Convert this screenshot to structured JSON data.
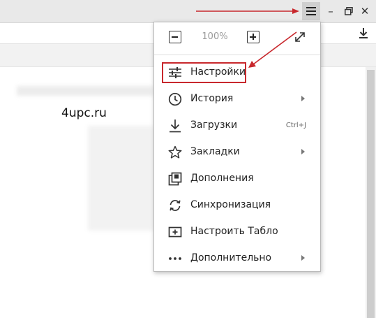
{
  "window": {
    "menu_icon": "hamburger-menu-icon",
    "minimize_glyph": "–",
    "restore_glyph": "❐",
    "close_glyph": "✕"
  },
  "watermark": "4upc.ru",
  "menu": {
    "zoom": {
      "value": "100%"
    },
    "items": [
      {
        "label": "Настройки",
        "icon": "settings-sliders-icon",
        "shortcut": "",
        "has_submenu": false,
        "highlighted": true
      },
      {
        "label": "История",
        "icon": "clock-icon",
        "shortcut": "",
        "has_submenu": true,
        "highlighted": false
      },
      {
        "label": "Загрузки",
        "icon": "download-icon",
        "shortcut": "Ctrl+J",
        "has_submenu": false,
        "highlighted": false
      },
      {
        "label": "Закладки",
        "icon": "star-icon",
        "shortcut": "",
        "has_submenu": true,
        "highlighted": false
      },
      {
        "label": "Дополнения",
        "icon": "extensions-icon",
        "shortcut": "",
        "has_submenu": false,
        "highlighted": false
      },
      {
        "label": "Синхронизация",
        "icon": "sync-icon",
        "shortcut": "",
        "has_submenu": false,
        "highlighted": false
      },
      {
        "label": "Настроить Табло",
        "icon": "add-tile-icon",
        "shortcut": "",
        "has_submenu": false,
        "highlighted": false
      },
      {
        "label": "Дополнительно",
        "icon": "more-dots-icon",
        "shortcut": "",
        "has_submenu": true,
        "highlighted": false
      }
    ]
  },
  "colors": {
    "annotation_red": "#c8282d",
    "titlebar_bg": "#e9e9e9",
    "menu_border": "#b9b9b9"
  }
}
